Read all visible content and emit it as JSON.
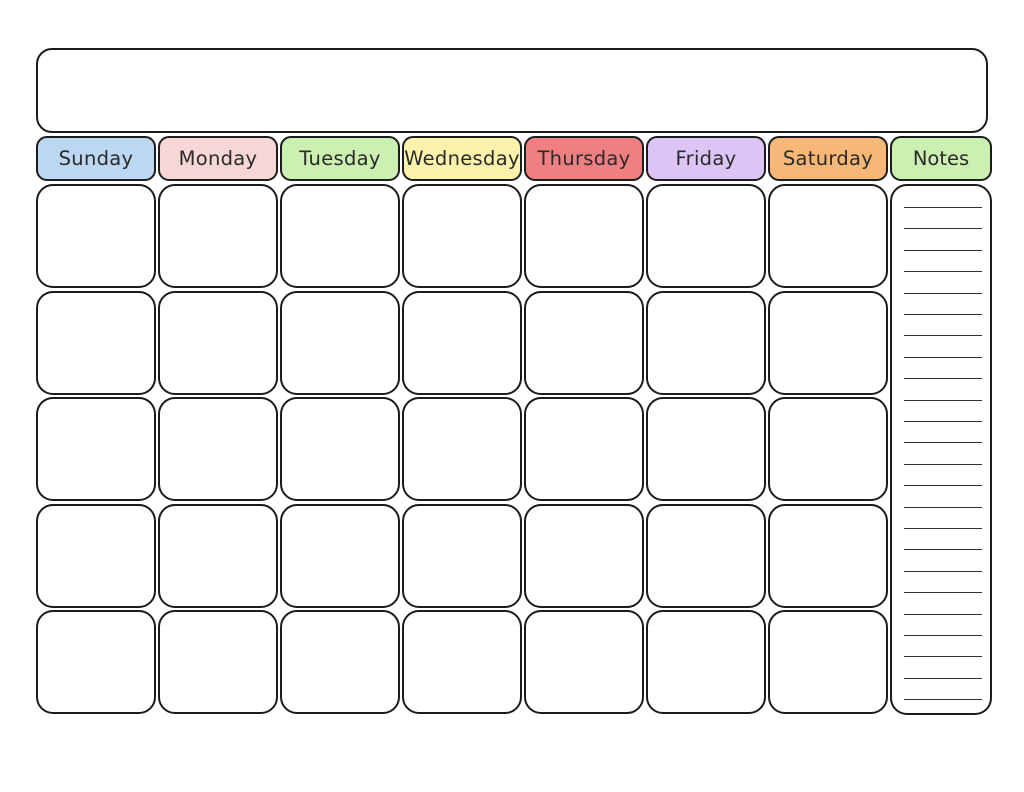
{
  "document": {
    "type": "blank-monthly-calendar-template",
    "title_bar_text": ""
  },
  "header": {
    "days": [
      {
        "label": "Sunday",
        "color": "#bcd7f2"
      },
      {
        "label": "Monday",
        "color": "#f7d6d6"
      },
      {
        "label": "Tuesday",
        "color": "#ccefb2"
      },
      {
        "label": "Wednesday",
        "color": "#fbf3ac"
      },
      {
        "label": "Thursday",
        "color": "#f07f82"
      },
      {
        "label": "Friday",
        "color": "#dcc4f5"
      },
      {
        "label": "Saturday",
        "color": "#f7b777"
      }
    ],
    "notes": {
      "label": "Notes",
      "color": "#ccefb2"
    }
  },
  "grid": {
    "columns": 7,
    "rows": 5,
    "cells": [
      [
        "",
        "",
        "",
        "",
        "",
        "",
        ""
      ],
      [
        "",
        "",
        "",
        "",
        "",
        "",
        ""
      ],
      [
        "",
        "",
        "",
        "",
        "",
        "",
        ""
      ],
      [
        "",
        "",
        "",
        "",
        "",
        "",
        ""
      ],
      [
        "",
        "",
        "",
        "",
        "",
        "",
        ""
      ]
    ]
  },
  "notes_panel": {
    "line_count": 24,
    "lines": [
      "",
      "",
      "",
      "",
      "",
      "",
      "",
      "",
      "",
      "",
      "",
      "",
      "",
      "",
      "",
      "",
      "",
      "",
      "",
      "",
      "",
      "",
      "",
      ""
    ]
  },
  "colors": {
    "border": "#1c1c1c",
    "page_background": "#ffffff",
    "cell_background": "#ffffff",
    "note_rule": "#2e2e2e"
  }
}
